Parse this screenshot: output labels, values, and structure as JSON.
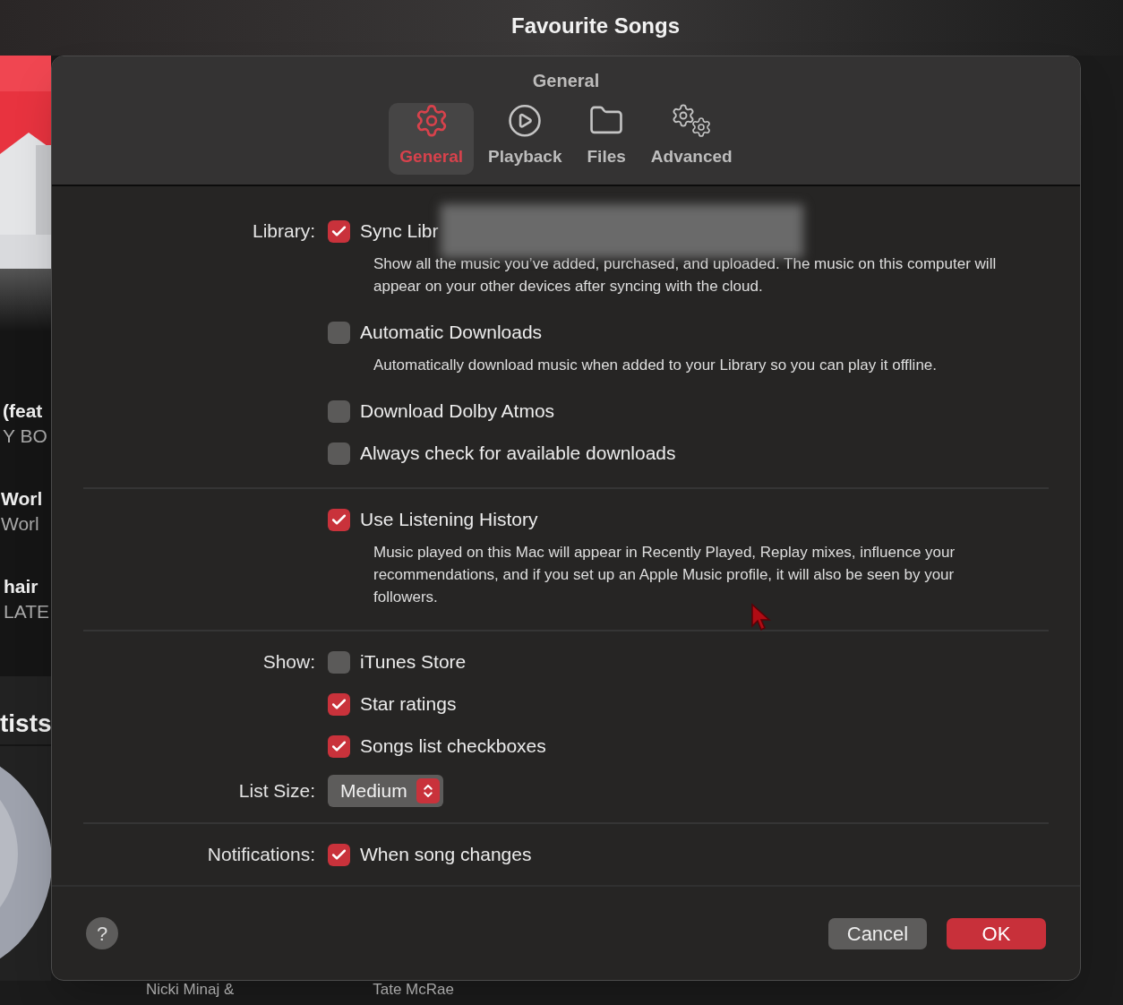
{
  "window": {
    "title": "Favourite Songs"
  },
  "background": {
    "lines": [
      {
        "text": "(feat",
        "kind": "title"
      },
      {
        "text": "Y BO",
        "kind": "subtitle"
      },
      {
        "text": "Worl",
        "kind": "title"
      },
      {
        "text": "Worl",
        "kind": "subtitle"
      },
      {
        "text": "hair",
        "kind": "title"
      },
      {
        "text": "LATE",
        "kind": "subtitle"
      },
      {
        "text": "tists",
        "kind": "heading"
      }
    ],
    "captions": [
      "Nicki Minaj &",
      "Tate McRae"
    ]
  },
  "dialog": {
    "title": "General",
    "tabs": [
      {
        "label": "General",
        "selected": true
      },
      {
        "label": "Playback",
        "selected": false
      },
      {
        "label": "Files",
        "selected": false
      },
      {
        "label": "Advanced",
        "selected": false
      }
    ],
    "sections": [
      {
        "rows": [
          {
            "kind": "checkbox",
            "label": "Library:",
            "text": "Sync Libr",
            "checked": true,
            "redacted": true,
            "description": "Show all the music you’ve added, purchased, and uploaded. The music on this computer will appear on your other devices after syncing with the cloud."
          },
          {
            "kind": "checkbox",
            "text": "Automatic Downloads",
            "checked": false,
            "description": "Automatically download music when added to your Library so you can play it offline."
          },
          {
            "kind": "checkbox",
            "text": "Download Dolby Atmos",
            "checked": false
          },
          {
            "kind": "checkbox",
            "text": "Always check for available downloads",
            "checked": false
          }
        ]
      },
      {
        "rows": [
          {
            "kind": "checkbox",
            "text": "Use Listening History",
            "checked": true,
            "description": "Music played on this Mac will appear in Recently Played, Replay mixes, influence your recommendations, and if you set up an Apple Music profile, it will also be seen by your followers."
          }
        ]
      },
      {
        "rows": [
          {
            "kind": "checkbox",
            "label": "Show:",
            "text": "iTunes Store",
            "checked": false
          },
          {
            "kind": "checkbox",
            "text": "Star ratings",
            "checked": true
          },
          {
            "kind": "checkbox",
            "text": "Songs list checkboxes",
            "checked": true
          },
          {
            "kind": "popup",
            "label": "List Size:",
            "value": "Medium"
          }
        ]
      },
      {
        "rows": [
          {
            "kind": "checkbox",
            "label": "Notifications:",
            "text": "When song changes",
            "checked": true
          }
        ]
      }
    ],
    "footer": {
      "help": "?",
      "buttons": [
        {
          "label": "Cancel",
          "kind": "secondary"
        },
        {
          "label": "OK",
          "kind": "primary"
        }
      ]
    }
  }
}
